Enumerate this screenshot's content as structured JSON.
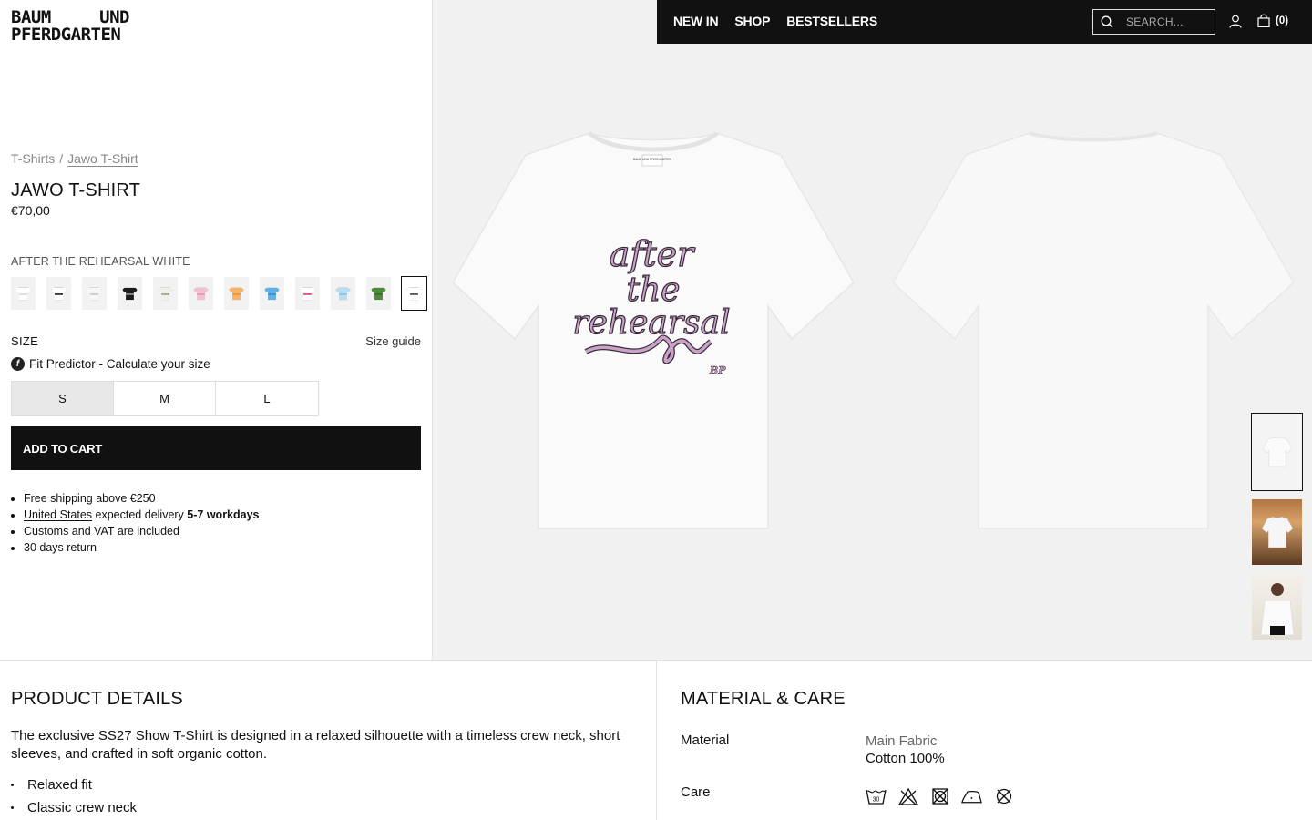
{
  "brand": {
    "line1_left": "BAUM",
    "line1_right": "UND",
    "line2": "PFERDGARTEN"
  },
  "nav": {
    "links": [
      "NEW IN",
      "SHOP",
      "BESTSELLERS"
    ],
    "search_placeholder": "SEARCH...",
    "user_icon": "user-icon",
    "cart_icon": "bag-icon",
    "cart_count": "(0)"
  },
  "breadcrumb": {
    "parent": "T-Shirts",
    "separator": "/",
    "current": "Jawo T-Shirt"
  },
  "product": {
    "title": "JAWO T-SHIRT",
    "price": "€70,00",
    "color_name": "AFTER THE REHEARSAL WHITE",
    "swatches": [
      {
        "color": "#ffffff",
        "print": "#dddddd"
      },
      {
        "color": "#ffffff",
        "print": "#333333"
      },
      {
        "color": "#f6f6f6",
        "print": "#cccccc"
      },
      {
        "color": "#1a1a1a",
        "print": "#888888"
      },
      {
        "color": "#f0f0ea",
        "print": "#aaa79a"
      },
      {
        "color": "#f3bfd2",
        "print": "#e59bb8"
      },
      {
        "color": "#f7b266",
        "print": "#e69a44"
      },
      {
        "color": "#5fb0e4",
        "print": "#3d8fc6"
      },
      {
        "color": "#ffffff",
        "print": "#e34b8d"
      },
      {
        "color": "#b9dcf2",
        "print": "#8ec2e6"
      },
      {
        "color": "#4e8a3a",
        "print": "#3a6e2a"
      },
      {
        "color": "#ffffff",
        "print": "#555555"
      }
    ],
    "size_label": "SIZE",
    "size_guide": "Size guide",
    "fit_predictor": "Fit Predictor - Calculate your size",
    "sizes": [
      "S",
      "M",
      "L"
    ],
    "selected_size": "S",
    "add_to_cart": "ADD TO CART",
    "info": {
      "shipping": "Free shipping above €250",
      "country": "United States",
      "delivery_text": "expected delivery",
      "delivery_time": "5-7 workdays",
      "customs": "Customs and VAT are included",
      "returns": "30 days return"
    },
    "print_text": [
      "after",
      "the",
      "rehearsal"
    ],
    "print_mark": "BP",
    "label_text": "BAUM UND PFERDGARTEN"
  },
  "details": {
    "heading": "PRODUCT DETAILS",
    "description": "The exclusive SS27 Show T-Shirt is designed in a relaxed silhouette with a timeless crew neck, short sleeves, and crafted in soft organic cotton.",
    "features": [
      "Relaxed fit",
      "Classic crew neck"
    ]
  },
  "care": {
    "heading": "MATERIAL & CARE",
    "material_label": "Material",
    "fabric_type": "Main Fabric",
    "fabric_value": "Cotton 100%",
    "care_label": "Care",
    "wash_temp": "30",
    "icons": [
      "wash-30-icon",
      "no-bleach-icon",
      "no-tumble-dry-icon",
      "iron-low-icon",
      "no-dry-clean-icon"
    ]
  },
  "colors": {
    "accent": "#111111",
    "print_fill": "#c9a3c7",
    "print_stroke": "#3a2a3a",
    "gallery_bg": "#f1f1f1"
  }
}
